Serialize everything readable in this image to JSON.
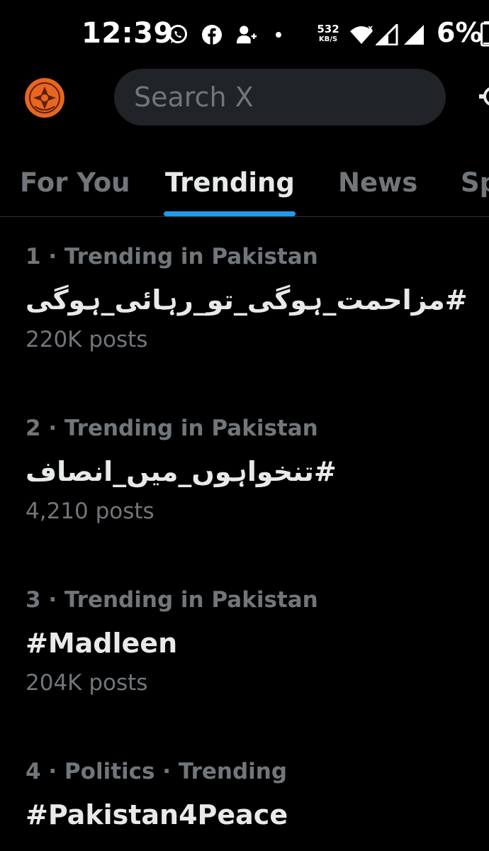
{
  "status_bar": {
    "time": "12:39",
    "net_speed": "532",
    "net_speed_unit": "KB/S",
    "battery": "6%",
    "icons": [
      "whatsapp-icon",
      "facebook-icon",
      "add-person-icon",
      "dot-icon",
      "wifi-icon",
      "signal-icon",
      "signal-icon",
      "battery-icon"
    ]
  },
  "header": {
    "search_placeholder": "Search X",
    "colors": {
      "search_bg": "#202327",
      "avatar": "#e8661f"
    }
  },
  "tabs": [
    {
      "label": "For You",
      "active": false
    },
    {
      "label": "Trending",
      "active": true
    },
    {
      "label": "News",
      "active": false
    },
    {
      "label": "Sp",
      "active": false
    }
  ],
  "accent_color": "#1d9bf0",
  "trends": [
    {
      "meta": "1 · Trending in Pakistan",
      "name": "#مزاحمت_ہوگی_تو_رہائی_ہوگی",
      "count": "220K posts"
    },
    {
      "meta": "2 · Trending in Pakistan",
      "name": "#تنخواہوں_میں_انصاف",
      "count": "4,210 posts"
    },
    {
      "meta": "3 · Trending in Pakistan",
      "name": "#Madleen",
      "count": "204K posts"
    },
    {
      "meta": "4 · Politics · Trending",
      "name": "#Pakistan4Peace",
      "count": ""
    }
  ]
}
